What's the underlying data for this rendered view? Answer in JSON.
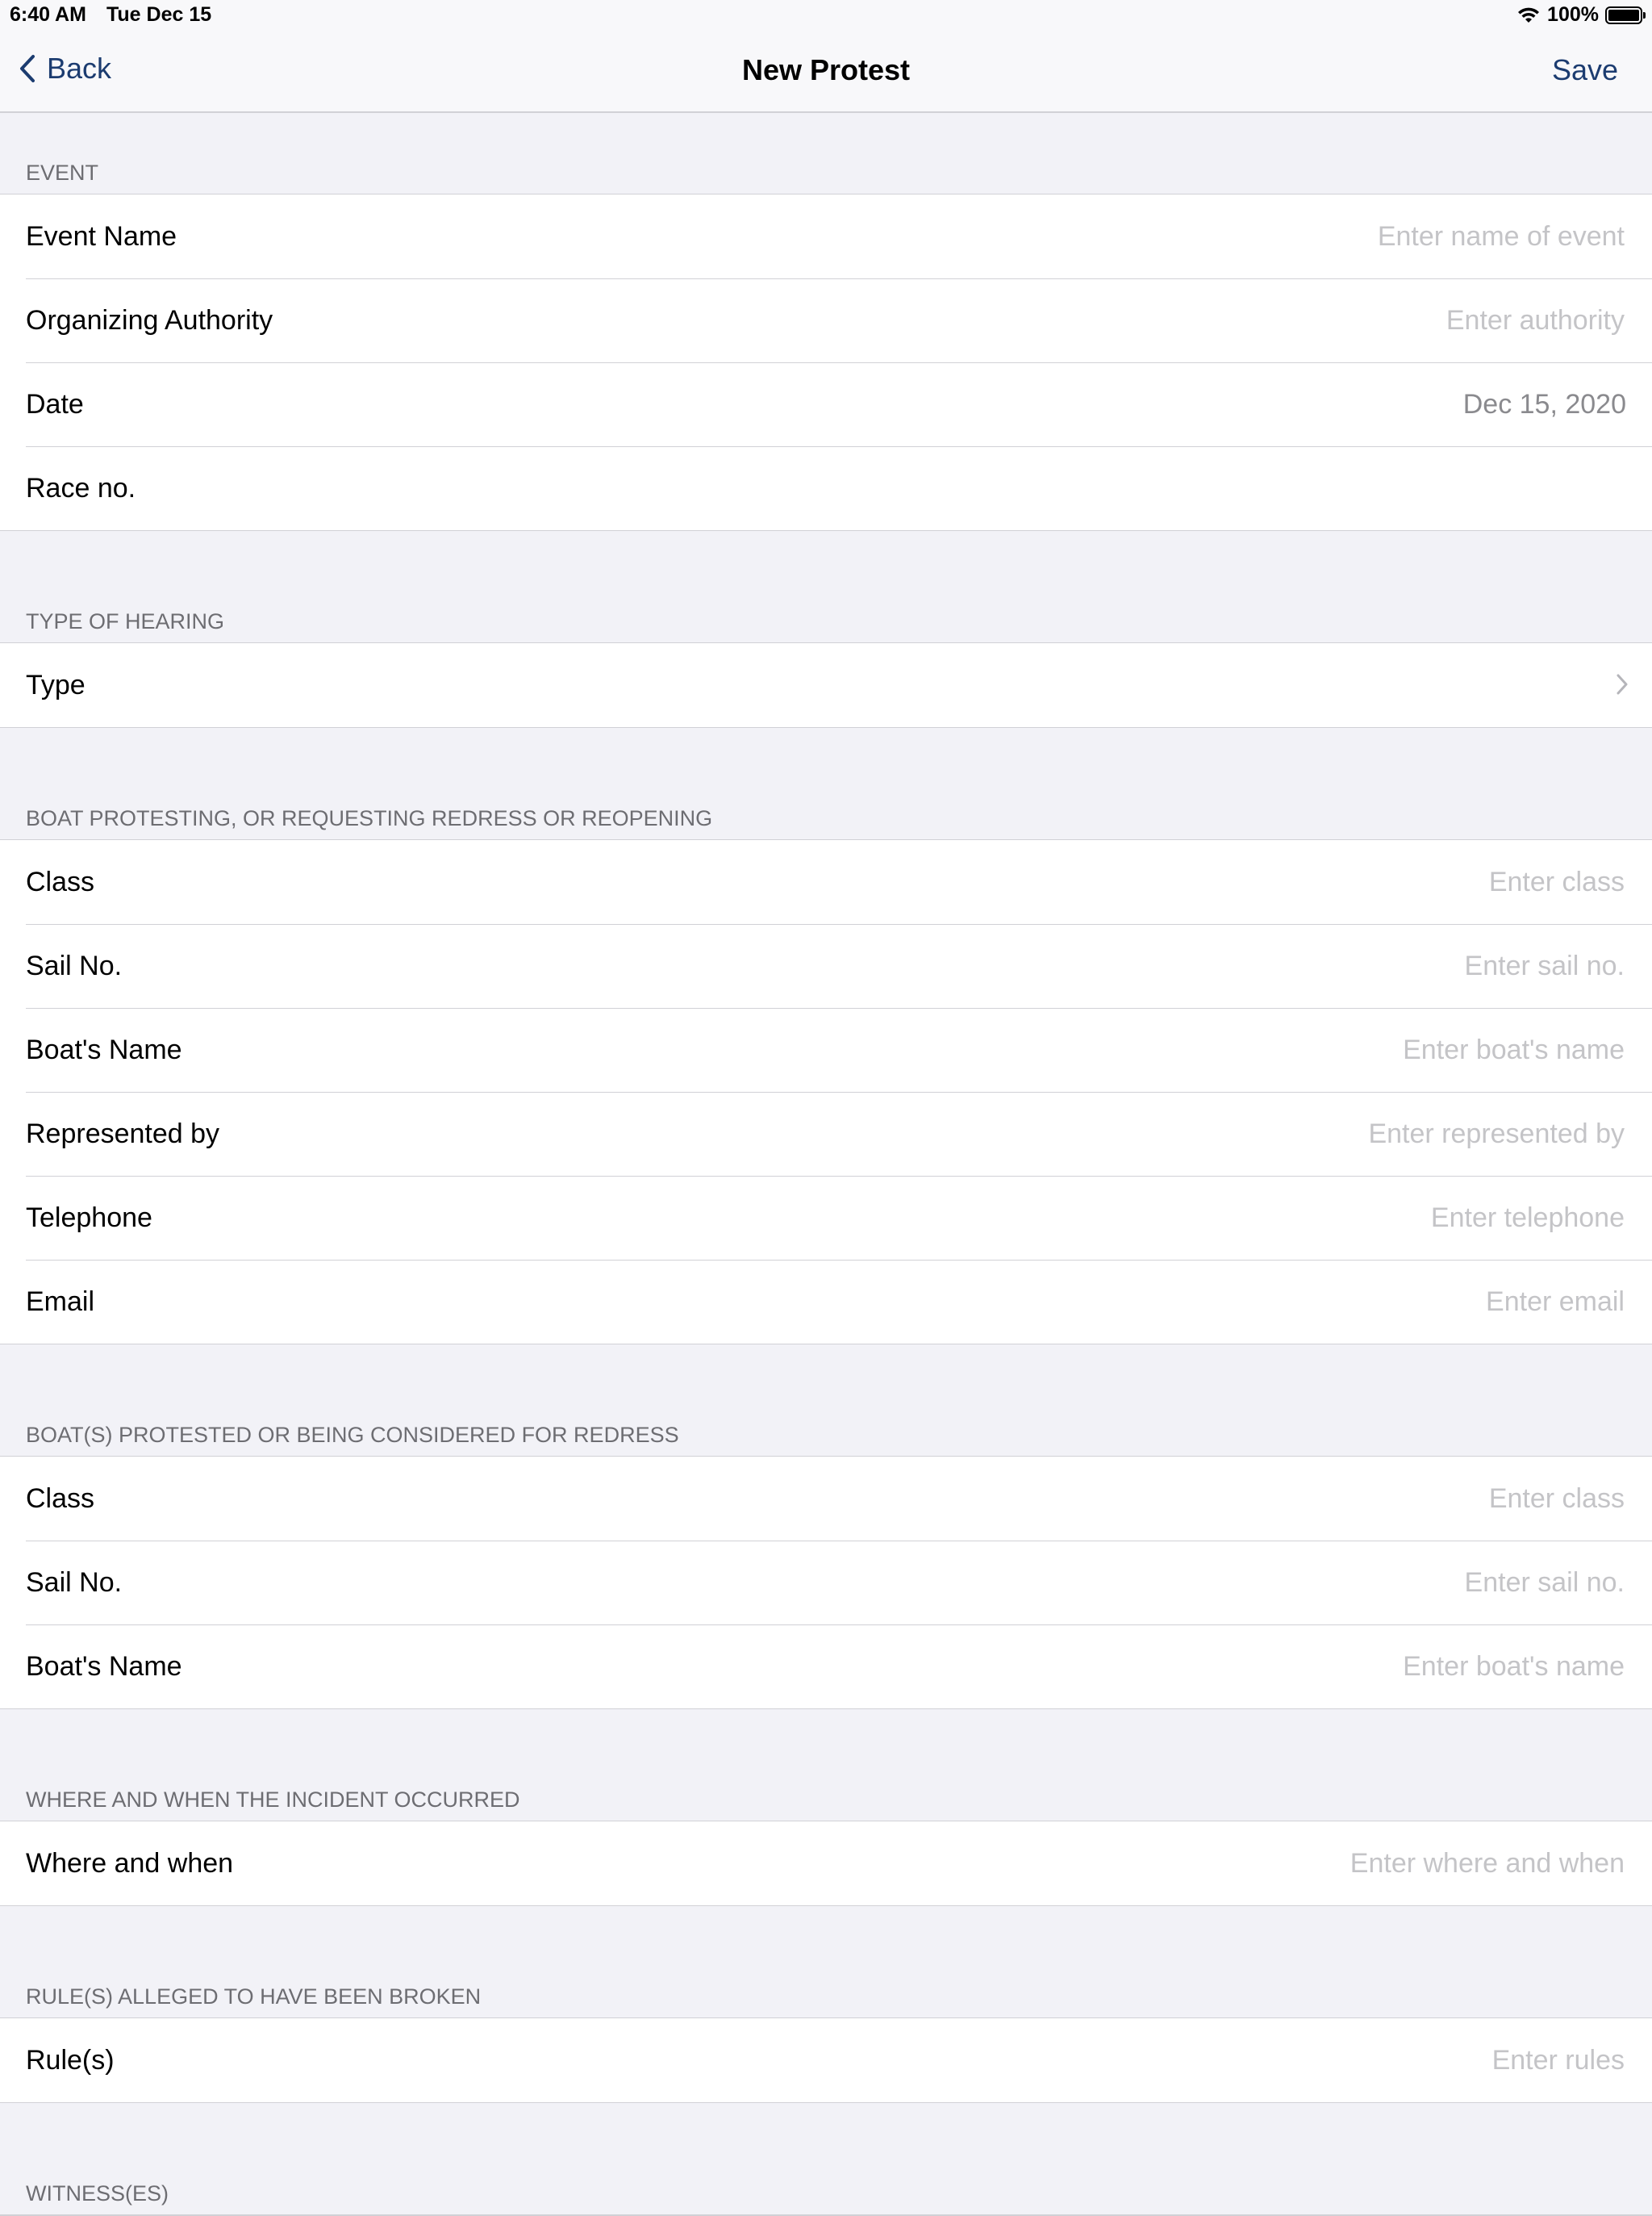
{
  "status_bar": {
    "time": "6:40 AM",
    "date": "Tue Dec 15",
    "battery": "100%",
    "battery_level": 1.0
  },
  "nav": {
    "back_label": "Back",
    "title": "New Protest",
    "save_label": "Save"
  },
  "colors": {
    "accent": "#1c3c70",
    "placeholder": "#c4c4c7",
    "background": "#f2f2f7",
    "section_header": "#6d6d72"
  },
  "event": {
    "header": "Event",
    "event_name": {
      "label": "Event Name",
      "placeholder": "Enter name of event",
      "value": ""
    },
    "organizing_authority": {
      "label": "Organizing Authority",
      "placeholder": "Enter authority",
      "value": ""
    },
    "date": {
      "label": "Date",
      "value": "Dec 15, 2020"
    },
    "race_no": {
      "label": "Race no.",
      "value": ""
    }
  },
  "hearing": {
    "header": "Type of Hearing",
    "type": {
      "label": "Type",
      "value": ""
    }
  },
  "protesting_boat": {
    "header": "Boat Protesting, or Requesting Redress or Reopening",
    "class": {
      "label": "Class",
      "placeholder": "Enter class",
      "value": ""
    },
    "sail_no": {
      "label": "Sail No.",
      "placeholder": "Enter sail no.",
      "value": ""
    },
    "boat_name": {
      "label": "Boat's Name",
      "placeholder": "Enter boat's name",
      "value": ""
    },
    "represented_by": {
      "label": "Represented by",
      "placeholder": "Enter represented by",
      "value": ""
    },
    "telephone": {
      "label": "Telephone",
      "placeholder": "Enter telephone",
      "value": ""
    },
    "email": {
      "label": "Email",
      "placeholder": "Enter email",
      "value": ""
    }
  },
  "protested_boat": {
    "header": "Boat(s) Protested or Being Considered for Redress",
    "class": {
      "label": "Class",
      "placeholder": "Enter class",
      "value": ""
    },
    "sail_no": {
      "label": "Sail No.",
      "placeholder": "Enter sail no.",
      "value": ""
    },
    "boat_name": {
      "label": "Boat's Name",
      "placeholder": "Enter boat's name",
      "value": ""
    }
  },
  "incident": {
    "header": "Where and When the Incident Occurred",
    "where_when": {
      "label": "Where and when",
      "placeholder": "Enter where and when",
      "value": ""
    }
  },
  "rules": {
    "header": "Rule(s) Alleged to Have Been Broken",
    "rules": {
      "label": "Rule(s)",
      "placeholder": "Enter rules",
      "value": ""
    }
  },
  "witnesses": {
    "header": "Witness(es)"
  }
}
